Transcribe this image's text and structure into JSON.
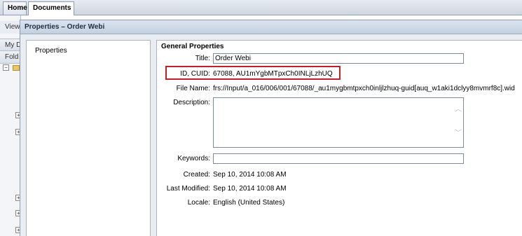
{
  "tabs": [
    {
      "label": "Home"
    },
    {
      "label": "Documents"
    }
  ],
  "background": {
    "view_label": "View",
    "my_label": "My D",
    "folder_label": "Fold"
  },
  "dialog": {
    "title": "Properties – Order Webi",
    "nav_items": [
      {
        "label": "Properties"
      }
    ],
    "section_title": "General Properties",
    "fields": {
      "title_label": "Title:",
      "title_value": "Order Webi",
      "id_label": "ID, CUID:",
      "id_value": "67088, AU1mYgbMTpxCh0INLjLzhUQ",
      "filename_label": "File Name:",
      "filename_value": "frs://Input/a_016/006/001/67088/_au1mygbmtpxch0inljlzhuq-guid[auq_w1aki1dclyy8mvmrf8c].wid",
      "description_label": "Description:",
      "description_value": "",
      "keywords_label": "Keywords:",
      "keywords_value": "",
      "created_label": "Created:",
      "created_value": "Sep 10, 2014 10:08 AM",
      "modified_label": "Last Modified:",
      "modified_value": "Sep 10, 2014 10:08 AM",
      "locale_label": "Locale:",
      "locale_value": "English (United States)"
    }
  },
  "colors": {
    "highlight_border": "#c0202a",
    "title_bar": "#c4d0df"
  },
  "icons": [
    "tree-expand-icon",
    "folder-icon",
    "scroll-up-icon",
    "scroll-down-icon"
  ]
}
